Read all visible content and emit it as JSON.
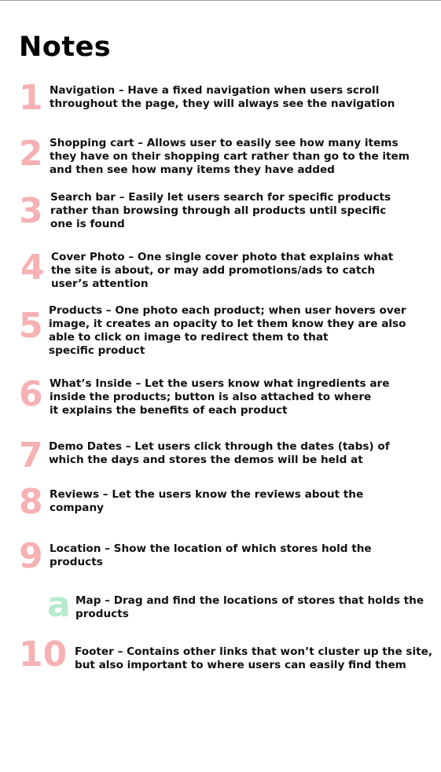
{
  "title": "Notes",
  "colors": {
    "number": "#f6b1b3",
    "sub_number": "#b6ebcd"
  },
  "notes": [
    {
      "number": "1",
      "lines": [
        "Navigation – Have a fixed navigation when users scroll",
        "throughout the page, they will always see the navigation"
      ]
    },
    {
      "number": "2",
      "lines": [
        "Shopping cart – Allows user to easily see how many items",
        "they have on their shopping cart rather than go to the item",
        "and then see how many items they have added"
      ]
    },
    {
      "number": "3",
      "lines": [
        "Search bar – Easily let users search for specific products",
        "rather than browsing through all products until specific",
        "one is found"
      ]
    },
    {
      "number": "4",
      "lines": [
        "Cover Photo – One single cover photo that explains what",
        "the site is about, or may add promotions/ads to catch",
        "user’s attention"
      ]
    },
    {
      "number": "5",
      "lines": [
        "Products – One photo each product; when user hovers over",
        "image, it creates an opacity to let them know they are also",
        "able to click on image to redirect them to that",
        "specific product"
      ]
    },
    {
      "number": "6",
      "lines": [
        "What’s Inside – Let the users know what ingredients are",
        "inside the products; button is also attached to where",
        "it explains the benefits of each product"
      ]
    },
    {
      "number": "7",
      "lines": [
        "Demo Dates – Let users click through the dates (tabs) of",
        "which the days and stores the demos will be held at"
      ]
    },
    {
      "number": "8",
      "lines": [
        "Reviews – Let the users know the reviews about the",
        "company"
      ]
    },
    {
      "number": "9",
      "lines": [
        "Location – Show the location of which stores hold the",
        "products"
      ]
    },
    {
      "number": "a",
      "lines": [
        "Map – Drag and find the locations of stores that holds the",
        "products"
      ]
    },
    {
      "number": "10",
      "lines": [
        "Footer – Contains other links that won’t cluster up the site,",
        "but also important to where users can easily find them"
      ]
    }
  ]
}
